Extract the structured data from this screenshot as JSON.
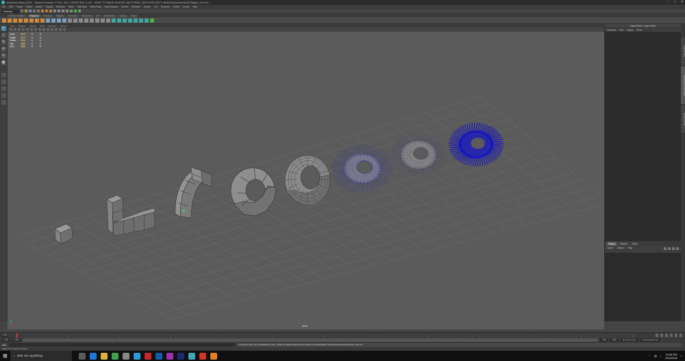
{
  "window": {
    "title": "Autodesk Maya 2016 - Student Version: F:\\20_TALL YEARS BIG 4-HD - HOW TO MAKE ALMOST ANYTHING_INFO\\PROJECT MAKAYA\\scenes\\SciFiObject_v01.mb",
    "minimize_icon": "minimize-icon",
    "maximize_icon": "maximize-icon",
    "close_icon": "close-icon"
  },
  "menubar": [
    "File",
    "Edit",
    "Create",
    "Select",
    "Modify",
    "Display",
    "Windows",
    "Mesh",
    "Edit Mesh",
    "Mesh Tools",
    "Mesh Display",
    "Curves",
    "Surfaces",
    "Deform",
    "UV",
    "Generate",
    "Cache",
    "Arnold",
    "Help"
  ],
  "statusline": {
    "mode": "Modeling"
  },
  "shelf_tabs": {
    "items": [
      "Curves / Surfaces",
      "Polygons",
      "Sculpting",
      "Rigging",
      "Animation",
      "Rendering",
      "FX",
      "FX Caching",
      "Custom",
      "XGen"
    ],
    "active_index": 1
  },
  "panel_menu": [
    "View",
    "Shading",
    "Lighting",
    "Show",
    "Renderer",
    "Panels"
  ],
  "hud": {
    "rows": [
      {
        "label": "Verts:",
        "value": "2144",
        "c1": "0",
        "c2": "0"
      },
      {
        "label": "Edges:",
        "value": "4272",
        "c1": "0",
        "c2": "0"
      },
      {
        "label": "Faces:",
        "value": "2144",
        "c1": "0",
        "c2": "0"
      },
      {
        "label": "Tris:",
        "value": "4288",
        "c1": "0",
        "c2": "0"
      },
      {
        "label": "UVs:",
        "value": "2304",
        "c1": "0",
        "c2": "0"
      }
    ]
  },
  "viewport": {
    "camera_label": "persp",
    "grid_color": "#6a6a6a",
    "selection_color": "#1010c8"
  },
  "right_panel": {
    "title": "Channel Box / Layer Editor",
    "menu": [
      "Channels",
      "Edit",
      "Object",
      "Show"
    ],
    "layer_tabs": [
      "Display",
      "Render",
      "Anim"
    ],
    "layer_menu": [
      "Layers",
      "Options",
      "Help"
    ]
  },
  "side_tabs": [
    "Attribute Editor",
    "Channel Box / Layer Editor",
    "Modeling Toolkit"
  ],
  "time_slider": {
    "current_frame": "1.00"
  },
  "range_slider": {
    "start": "1.00",
    "inner_start": "1.00",
    "inner_end": "120",
    "end": "120",
    "anim_end": "200",
    "layer": "No Anim Layer",
    "character": "No Character Set"
  },
  "command_line": {
    "mode": "MEL",
    "result": "// Result: F:\\20_TALL YEARS BIG 4-HD - HOW TO MAKE ALMOST ANYTHING_INFO\\PROJECT MAKAYA\\scenes\\SciFiObject_v01.mb"
  },
  "help_line": "Select Tool: select an object",
  "taskbar": {
    "search_placeholder": "Ask me anything",
    "time": "10:45 PM",
    "date": "10/4/2016"
  },
  "colors": {
    "accent": "#5285a6",
    "viewport_bg": "#5b5b5b",
    "panel_bg": "#3e3e3e"
  }
}
